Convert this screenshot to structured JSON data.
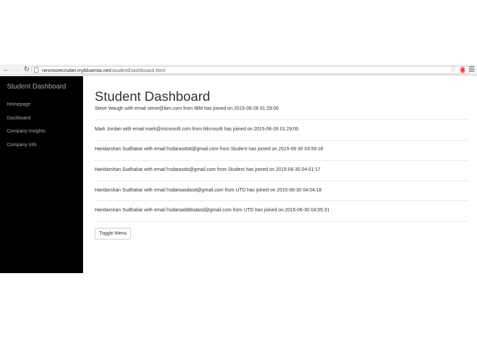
{
  "browser": {
    "url_host": "nexmorecruiter.mybluemix.net",
    "url_path": "/studentDashboard.html",
    "icons": [
      "back-icon",
      "forward-icon",
      "reload-icon",
      "page-icon",
      "star-icon",
      "opera-icon",
      "menu-icon"
    ]
  },
  "sidebar": {
    "brand": "Student Dashboard",
    "items": [
      {
        "label": "Homepage"
      },
      {
        "label": "Dashboard"
      },
      {
        "label": "Company Insights"
      },
      {
        "label": "Company Info"
      }
    ]
  },
  "main": {
    "title": "Student Dashboard",
    "entries": [
      "Steve Waugh with email steve@ibm.com from IBM has joined on 2015-06-28 01:29:06",
      "Mark Jordan with email mark@microsoft.com from Microsoft has joined on 2015-06-28 01:29:06",
      "Haridarshan Sudhakar with email hsdarasds8@gmail.com from Student has joined on 2015-06-30 03:59:18",
      "Haridarshan Sudhakar with email hsdarasds@gmail.com from Student has joined on 2015-06-30 04:01:17",
      "Haridarshan Sudhakar with email hsdarsasdasd@gmail.com from UTD has joined on 2015-06-30 04:04:18",
      "Haridarshan Sudhakar with email hsdarsadddsdasd@gmail.com from UTD has joined on 2015-06-30 04:05:31"
    ],
    "toggle_label": "Toggle Menu"
  },
  "colors": {
    "sidebar_bg": "#000000",
    "sidebar_text": "#a8a8a8",
    "body_text": "#333333"
  }
}
